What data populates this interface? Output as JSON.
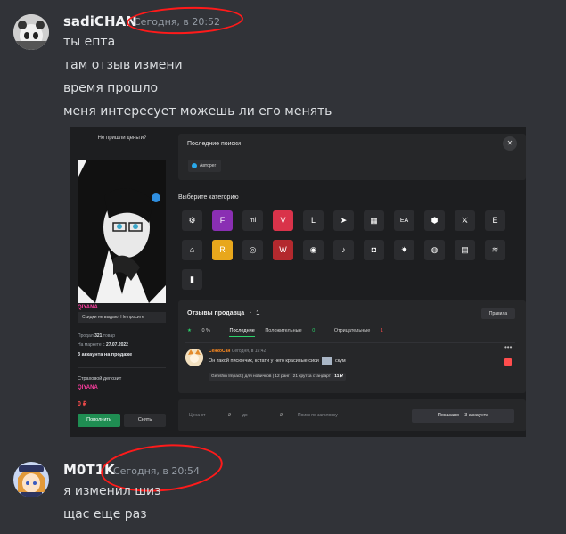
{
  "messages": [
    {
      "username": "sadiCHAN",
      "timestamp": "Сегодня, в 20:52",
      "lines": [
        "ты епта",
        "там отзыв измени",
        "время прошло",
        "меня интересует можешь ли его менять"
      ]
    },
    {
      "username": "M0T1K",
      "timestamp": "Сегодня, в 20:54",
      "lines": [
        "я изменил шиз",
        "щас еще раз"
      ]
    }
  ],
  "screenshot": {
    "left": {
      "top_text": "Не пришли деньги?",
      "seller_name": "QIYANA",
      "note": "Скидки не выдаю! Не просите",
      "sales_label": "Продал",
      "sales_count": "321",
      "sales_suffix": "товар",
      "market_label": "На маркете с",
      "market_date": "27.07.2022",
      "accounts_on_sale": "3 аккаунта на продаже",
      "deposit_title": "Страховой депозит",
      "deposit_name": "QIYANA",
      "deposit_amount": "0 ₽",
      "topup_button": "Пополнить",
      "withdraw_button": "Снять"
    },
    "recent": {
      "title": "Последние поиски",
      "chip": "Авторег"
    },
    "categories": {
      "title": "Выберите категорию",
      "icons": [
        {
          "name": "steam-icon",
          "glyph": "⚙",
          "bg": "#2b2c2f"
        },
        {
          "name": "fortnite-icon",
          "glyph": "F",
          "bg": "#8a2fb3"
        },
        {
          "name": "mihoyo-icon",
          "glyph": "mi",
          "bg": "#2b2c2f"
        },
        {
          "name": "valorant-icon",
          "glyph": "V",
          "bg": "#d9334a"
        },
        {
          "name": "league-icon",
          "glyph": "L",
          "bg": "#2b2c2f"
        },
        {
          "name": "telegram-icon",
          "glyph": "➤",
          "bg": "#2b2c2f"
        },
        {
          "name": "supercell-icon",
          "glyph": "▦",
          "bg": "#2b2c2f"
        },
        {
          "name": "ea-icon",
          "glyph": "EA",
          "bg": "#2b2c2f"
        },
        {
          "name": "wot-icon",
          "glyph": "⬢",
          "bg": "#2b2c2f"
        },
        {
          "name": "warface-icon",
          "glyph": "⚔",
          "bg": "#2b2c2f"
        },
        {
          "name": "epic-icon",
          "glyph": "E",
          "bg": "#2b2c2f"
        },
        {
          "name": "escape-icon",
          "glyph": "⌂",
          "bg": "#2b2c2f"
        },
        {
          "name": "rockstar-icon",
          "glyph": "R",
          "bg": "#e8a71c"
        },
        {
          "name": "uplay-icon",
          "glyph": "◎",
          "bg": "#2b2c2f"
        },
        {
          "name": "wargaming-icon",
          "glyph": "W",
          "bg": "#b3292e"
        },
        {
          "name": "discord-icon",
          "glyph": "◉",
          "bg": "#2b2c2f"
        },
        {
          "name": "tiktok-icon",
          "glyph": "♪",
          "bg": "#2b2c2f"
        },
        {
          "name": "instagram-icon",
          "glyph": "◘",
          "bg": "#2b2c2f"
        },
        {
          "name": "battlenet-icon",
          "glyph": "✷",
          "bg": "#2b2c2f"
        },
        {
          "name": "vpn-icon",
          "glyph": "◍",
          "bg": "#2b2c2f"
        },
        {
          "name": "cinema-icon",
          "glyph": "▤",
          "bg": "#2b2c2f"
        },
        {
          "name": "spotify-icon",
          "glyph": "≋",
          "bg": "#2b2c2f"
        },
        {
          "name": "stats-icon",
          "glyph": "▮",
          "bg": "#2b2c2f"
        }
      ]
    },
    "reviews": {
      "title": "Отзывы продавца",
      "count": "1",
      "rules_button": "Правила",
      "rating": "0 %",
      "tabs": [
        "Последние",
        "Положительные",
        "Отрицательные"
      ],
      "positive_count": "0",
      "negative_count": "1",
      "review": {
        "author": "СенкоСан",
        "date": "Сегодня, в 15:42",
        "text": "Он такой писюнчик, кстати у него красивые сиси",
        "text_end": "скум",
        "tag": "Genshin Impact | для новичков | 12 ранг | 21 крутка стандарт",
        "tag_price": "11 ₽"
      }
    },
    "filter": {
      "price_from": "Цена от",
      "price_to": "до",
      "currency": "₽",
      "search_placeholder": "Поиск по заголовку",
      "show_button": "Показано – 3 аккаунта"
    }
  }
}
